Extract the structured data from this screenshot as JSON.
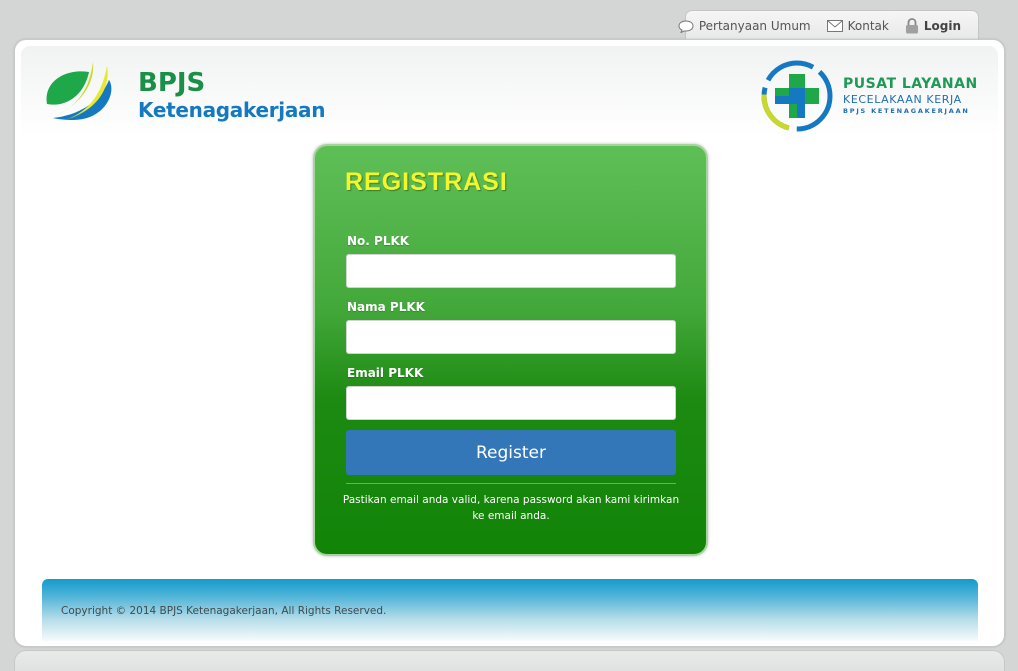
{
  "topnav": {
    "faq_label": "Pertanyaan Umum",
    "contact_label": "Kontak",
    "login_label": "Login"
  },
  "header": {
    "brand_title": "BPJS",
    "brand_subtitle": "Ketenagakerjaan",
    "partner_line1": "PUSAT LAYANAN",
    "partner_line2": "KECELAKAAN KERJA",
    "partner_line3": "BPJS KETENAGAKERJAAN"
  },
  "form": {
    "title": "REGISTRASI",
    "fields": [
      {
        "label": "No. PLKK",
        "value": ""
      },
      {
        "label": "Nama PLKK",
        "value": ""
      },
      {
        "label": "Email PLKK",
        "value": ""
      }
    ],
    "submit_label": "Register",
    "note": "Pastikan email anda valid, karena password akan kami kirimkan ke email anda."
  },
  "footer": {
    "copyright": "Copyright © 2014 BPJS Ketenagakerjaan, All Rights Reserved."
  },
  "colors": {
    "brand_green": "#1a8f47",
    "brand_blue": "#1479c0",
    "panel_green": "#118407",
    "title_yellow": "#f4f52a",
    "button_blue": "#3477b9",
    "footer_blue": "#149bcb"
  }
}
